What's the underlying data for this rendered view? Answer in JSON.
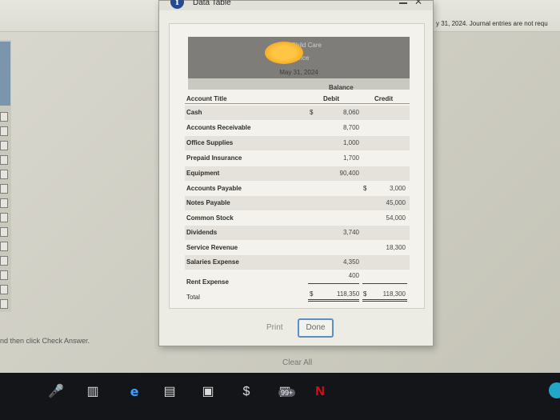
{
  "window": {
    "title": "Data Table",
    "info_icon": "i"
  },
  "background": {
    "instructions": "y 31, 2024. Journal entries are not requ",
    "bottom_text": "nd then click Check Answer.",
    "clear_all": "Clear All"
  },
  "statement": {
    "line1": "Ch... Child Care",
    "line2": "...lance",
    "date": "May 31, 2024",
    "balance_label": "Balance",
    "columns": {
      "title": "Account Title",
      "debit": "Debit",
      "credit": "Credit"
    },
    "rows": [
      {
        "account": "Cash",
        "dsign": "$",
        "debit": "8,060",
        "csign": "",
        "credit": ""
      },
      {
        "account": "Accounts Receivable",
        "dsign": "",
        "debit": "8,700",
        "csign": "",
        "credit": ""
      },
      {
        "account": "Office Supplies",
        "dsign": "",
        "debit": "1,000",
        "csign": "",
        "credit": ""
      },
      {
        "account": "Prepaid Insurance",
        "dsign": "",
        "debit": "1,700",
        "csign": "",
        "credit": ""
      },
      {
        "account": "Equipment",
        "dsign": "",
        "debit": "90,400",
        "csign": "",
        "credit": ""
      },
      {
        "account": "Accounts Payable",
        "dsign": "",
        "debit": "",
        "csign": "$",
        "credit": "3,000"
      },
      {
        "account": "Notes Payable",
        "dsign": "",
        "debit": "",
        "csign": "",
        "credit": "45,000"
      },
      {
        "account": "Common Stock",
        "dsign": "",
        "debit": "",
        "csign": "",
        "credit": "54,000"
      },
      {
        "account": "Dividends",
        "dsign": "",
        "debit": "3,740",
        "csign": "",
        "credit": ""
      },
      {
        "account": "Service Revenue",
        "dsign": "",
        "debit": "",
        "csign": "",
        "credit": "18,300"
      },
      {
        "account": "Salaries Expense",
        "dsign": "",
        "debit": "4,350",
        "csign": "",
        "credit": ""
      },
      {
        "account": "Rent Expense",
        "dsign": "",
        "debit": "400",
        "csign": "",
        "credit": ""
      },
      {
        "account": "Total",
        "dsign": "$",
        "debit": "118,350",
        "csign": "$",
        "credit": "118,300"
      }
    ]
  },
  "buttons": {
    "print": "Print",
    "done": "Done"
  },
  "taskbar": {
    "badge": "99+",
    "netflix": "N"
  }
}
